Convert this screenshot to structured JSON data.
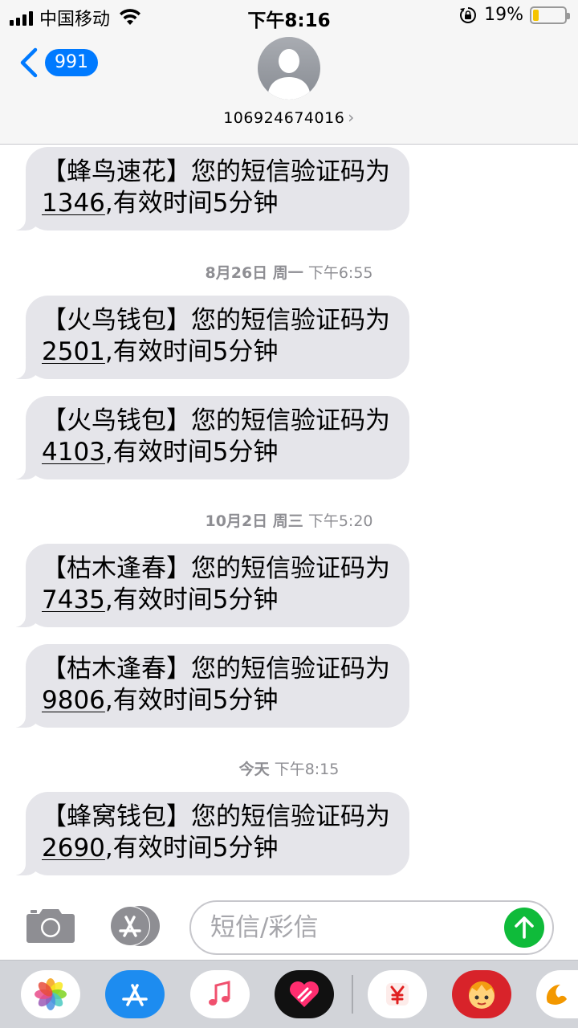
{
  "status_bar": {
    "carrier": "中国移动",
    "time": "下午8:16",
    "battery_percent": "19%",
    "battery_level": 0.19
  },
  "nav": {
    "back_count": "991",
    "contact": "106924674016",
    "contact_chevron": "›"
  },
  "thread": {
    "messages": [
      {
        "text_before": "【蜂鸟速花】您的短信验证码为",
        "code": "1346",
        "text_after": ",有效时间5分钟"
      },
      {
        "text_before": "【火鸟钱包】您的短信验证码为",
        "code": "2501",
        "text_after": ",有效时间5分钟"
      },
      {
        "text_before": "【火鸟钱包】您的短信验证码为",
        "code": "4103",
        "text_after": ",有效时间5分钟"
      },
      {
        "text_before": "【枯木逢春】您的短信验证码为",
        "code": "7435",
        "text_after": ",有效时间5分钟"
      },
      {
        "text_before": "【枯木逢春】您的短信验证码为",
        "code": "9806",
        "text_after": ",有效时间5分钟"
      },
      {
        "text_before": "【蜂窝钱包】您的短信验证码为",
        "code": "2690",
        "text_after": ",有效时间5分钟"
      }
    ],
    "timestamps": [
      {
        "date": "8月26日 周一",
        "time": "下午6:55"
      },
      {
        "date": "10月2日 周三",
        "time": "下午5:20"
      },
      {
        "date": "今天",
        "time": "下午8:15"
      }
    ]
  },
  "input": {
    "placeholder": "短信/彩信"
  },
  "colors": {
    "accent": "#007aff",
    "send": "#0fbb3a",
    "bubble": "#e5e5ea"
  },
  "drawer": {
    "apps": [
      "photos-icon",
      "app-store-icon",
      "music-icon",
      "digital-touch-icon",
      "yen-app-icon",
      "sticker-app-icon",
      "uc-app-icon"
    ]
  }
}
